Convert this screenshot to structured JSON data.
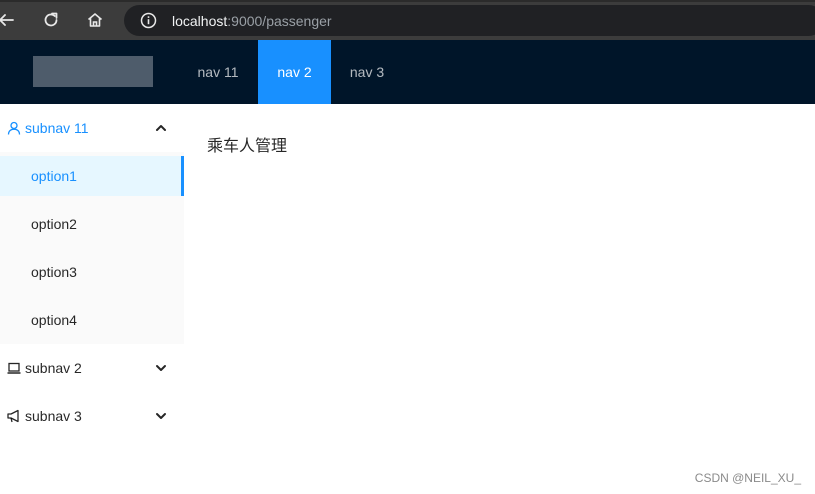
{
  "browser": {
    "url_host": "localhost",
    "url_rest": ":9000/passenger",
    "icons": [
      "back-arrow-icon",
      "reload-icon",
      "home-icon",
      "info-icon"
    ]
  },
  "header": {
    "nav": [
      {
        "label": "nav 11"
      },
      {
        "label": "nav 2",
        "active": true
      },
      {
        "label": "nav 3"
      }
    ]
  },
  "sidebar": {
    "submenus": [
      {
        "label": "subnav 11",
        "icon": "user-icon",
        "open": true,
        "items": [
          {
            "label": "option1",
            "selected": true
          },
          {
            "label": "option2"
          },
          {
            "label": "option3"
          },
          {
            "label": "option4"
          }
        ]
      },
      {
        "label": "subnav 2",
        "icon": "laptop-icon",
        "open": false
      },
      {
        "label": "subnav 3",
        "icon": "notification-icon",
        "open": false
      }
    ]
  },
  "content": {
    "title": "乘车人管理"
  },
  "watermark": "CSDN @NEIL_XU_",
  "colors": {
    "header_bg": "#001529",
    "accent": "#1890ff",
    "selected_bg": "#e6f7ff"
  }
}
